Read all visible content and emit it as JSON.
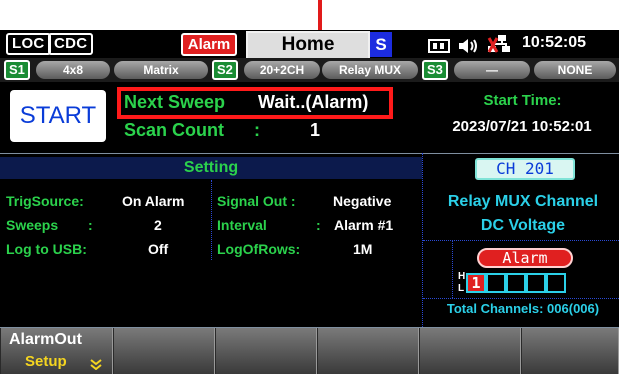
{
  "status_bar": {
    "loc": "LOC",
    "cdc": "CDC",
    "alarm": "Alarm",
    "home_tab": "Home",
    "s_indicator": "S",
    "icons": [
      "usb-icon",
      "speaker-icon",
      "network-disconnected-icon"
    ],
    "time": "10:52:05"
  },
  "slots": [
    {
      "id": "S1",
      "label": "4x8",
      "sub": "Matrix"
    },
    {
      "id": "S2",
      "label": "20+2CH",
      "sub": "Relay MUX"
    },
    {
      "id": "S3",
      "label": "—",
      "sub": "NONE"
    }
  ],
  "sweep": {
    "start_label": "START",
    "next_sweep_label": "Next Sweep",
    "next_sweep_value": "Wait..(Alarm)",
    "scan_count_label": "Scan Count",
    "scan_count_sep": ":",
    "scan_count_value": "1",
    "start_time_label": "Start Time:",
    "start_time_value": "2023/07/21 10:52:01"
  },
  "setting": {
    "title": "Setting",
    "rows": [
      {
        "label": "TrigSource:",
        "value": "On Alarm"
      },
      {
        "label": "Sweeps",
        "sep": ":",
        "value": "2"
      },
      {
        "label": "Log to USB:",
        "value": "Off"
      }
    ],
    "rows_right": [
      {
        "label": "Signal Out :",
        "value": "Negative"
      },
      {
        "label": "Interval",
        "sep": ":",
        "value": "Alarm #1"
      },
      {
        "label": "LogOfRows:",
        "value": "1M"
      }
    ]
  },
  "channel": {
    "badge": "CH 201",
    "line1": "Relay MUX Channel",
    "line2": "DC Voltage",
    "alarm_label": "Alarm",
    "h": "H",
    "l": "L",
    "cell_active": "1",
    "total": "Total Channels: 006(006)"
  },
  "softkeys": [
    {
      "title": "AlarmOut",
      "sub": "Setup"
    },
    {
      "title": "",
      "sub": ""
    },
    {
      "title": "",
      "sub": ""
    },
    {
      "title": "",
      "sub": ""
    },
    {
      "title": "",
      "sub": ""
    },
    {
      "title": "",
      "sub": ""
    }
  ]
}
